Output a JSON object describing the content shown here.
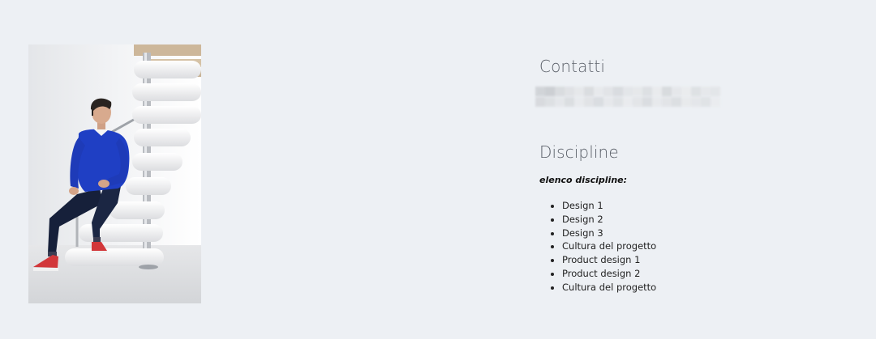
{
  "photo": {
    "alt": "portrait of a man in a blue sweater sitting on a white spiral staircase"
  },
  "contacts": {
    "title": "Contatti"
  },
  "disciplines": {
    "title": "Discipline",
    "intro": "elenco discipline:",
    "items": [
      "Design 1",
      "Design 2",
      "Design 3",
      "Cultura del progetto",
      "Product design 1",
      "Product design 2",
      "Cultura del progetto"
    ]
  },
  "colors": {
    "background": "#edf0f4",
    "title": "#5b6069",
    "text": "#222222",
    "sweater": "#1f3fc4",
    "shoes": "#d2373a"
  }
}
